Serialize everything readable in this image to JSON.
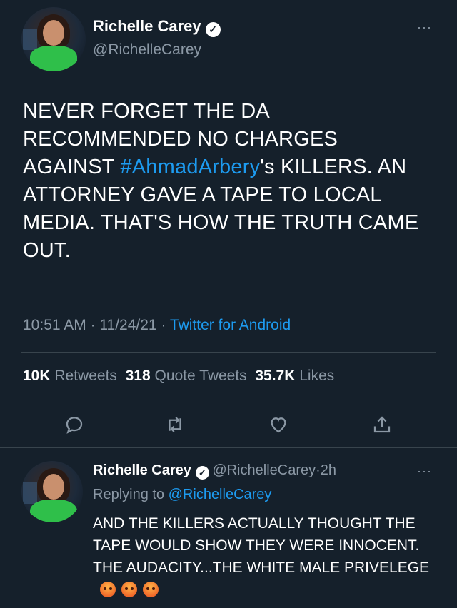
{
  "tweet": {
    "author_name": "Richelle Carey",
    "author_handle": "@RichelleCarey",
    "text_before": "NEVER FORGET THE DA RECOMMENDED NO CHARGES AGAINST ",
    "hashtag": "#AhmadArbery",
    "text_after": "'s KILLERS. AN ATTORNEY GAVE A TAPE TO LOCAL MEDIA. THAT'S HOW THE TRUTH CAME OUT.",
    "time": "10:51 AM",
    "separator": "·",
    "date": "11/24/21",
    "source": "Twitter for Android",
    "more_label": "···"
  },
  "stats": {
    "retweets_count": "10K",
    "retweets_label": "Retweets",
    "quotes_count": "318",
    "quotes_label": "Quote Tweets",
    "likes_count": "35.7K",
    "likes_label": "Likes"
  },
  "actions": [
    "reply-icon",
    "retweet-icon",
    "like-icon",
    "share-icon"
  ],
  "reply": {
    "author_name": "Richelle Carey",
    "author_handle": "@RichelleCarey",
    "separator": "·",
    "time_ago": "2h",
    "replying_prefix": "Replying to",
    "replying_mention": "@RichelleCarey",
    "text": "AND THE KILLERS ACTUALLY THOUGHT THE TAPE WOULD SHOW THEY WERE INNOCENT. THE AUDACITY...THE WHITE MALE PRIVELEGE",
    "emoji_icon": "angry-face-icon",
    "more_label": "···"
  },
  "colors": {
    "background": "#15202b",
    "accent": "#1d9bf0",
    "muted": "#8b98a5",
    "divider": "#38444d"
  }
}
